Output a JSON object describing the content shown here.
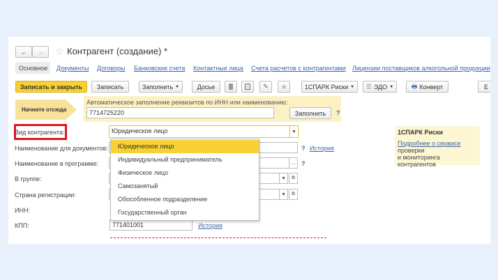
{
  "window": {
    "title": "Контрагент (создание) *"
  },
  "tabs": [
    "Основное",
    "Документы",
    "Договоры",
    "Банковские счета",
    "Контактные лица",
    "Счета расчетов с контрагентами",
    "Лицензии поставщиков алкогольной продукции"
  ],
  "toolbar": {
    "save_close": "Записать и закрыть",
    "save": "Записать",
    "fill": "Заполнить",
    "dossier": "Досье",
    "spark": "1СПАРК Риски",
    "edo": "ЭДО",
    "envelope": "Конверт",
    "more": "Е"
  },
  "autofill": {
    "start_here": "Начните отсюда",
    "label": "Автоматическое заполнение реквизитов по ИНН или наименованию:",
    "value": "7714725220",
    "button": "Заполнить",
    "help": "?"
  },
  "form": {
    "kind_label": "Вид контрагента:",
    "kind_value": "Юридическое лицо",
    "doc_name_label": "Наименование для документов:",
    "history": "История",
    "help": "?",
    "prog_name_label": "Наименование в программе:",
    "ellipsis": "...",
    "group_label": "В группе:",
    "country_label": "Страна регистрации:",
    "inn_label": "ИНН:",
    "kpp_label": "КПП:",
    "kpp_value": "771401001",
    "kpp_history": "История"
  },
  "dropdown": {
    "options": [
      "Юридическое лицо",
      "Индивидуальный предприниматель",
      "Физическое лицо",
      "Самозанятый",
      "Обособленное подразделение",
      "Государственный орган"
    ],
    "selected": 0
  },
  "spark_panel": {
    "title": "1СПАРК Риски",
    "link": "Подробнее о сервисе",
    "text1": "проверки",
    "text2": "и мониторинга контрагентов"
  },
  "colors": {
    "accent": "#f7d133",
    "highlight_box": "#e5131f",
    "panel": "#fdf1c4",
    "link": "#3d63a8"
  }
}
